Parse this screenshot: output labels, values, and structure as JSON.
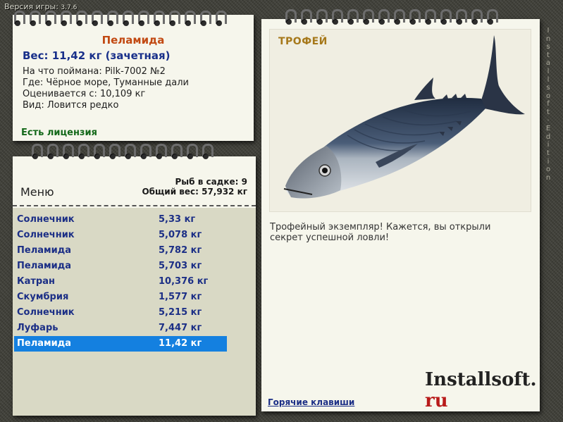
{
  "version": {
    "label": "Версия игры:",
    "number": "3.7.6"
  },
  "side_text": "Installsoft Edition",
  "fish": {
    "name": "Пеламида",
    "weight_line": "Вес: 11,42 кг (зачетная)",
    "caught_with": "На что поймана: Pilk-7002 №2",
    "location": "Где: Чёрное море, Туманные дали",
    "valued_at": "Оценивается с: 10,109 кг",
    "type": "Вид: Ловится редко",
    "license": "Есть лицензия"
  },
  "list": {
    "menu_label": "Меню",
    "fish_count": "Рыб в садке: 9",
    "total_weight": "Общий вес: 57,932 кг",
    "rows": [
      {
        "name": "Солнечник",
        "weight": "5,33 кг"
      },
      {
        "name": "Солнечник",
        "weight": "5,078 кг"
      },
      {
        "name": "Пеламида",
        "weight": "5,782 кг"
      },
      {
        "name": "Пеламида",
        "weight": "5,703 кг"
      },
      {
        "name": "Катран",
        "weight": "10,376 кг"
      },
      {
        "name": "Скумбрия",
        "weight": "1,577 кг"
      },
      {
        "name": "Солнечник",
        "weight": "5,215 кг"
      },
      {
        "name": "Луфарь",
        "weight": "7,447 кг"
      },
      {
        "name": "Пеламида",
        "weight": "11,42 кг"
      }
    ],
    "selected_index": 8
  },
  "trophy": {
    "label": "ТРОФЕЙ",
    "text": "Трофейный экземпляр! Кажется, вы открыли секрет успешной ловли!",
    "brand_main": "Installsoft.",
    "brand_tld": "ru",
    "hotkeys_link": "Горячие клавиши"
  },
  "colors": {
    "selected_row": "#1480e0",
    "fish_name": "#c24a13",
    "link_blue": "#1c2f86",
    "license_green": "#14691a"
  }
}
